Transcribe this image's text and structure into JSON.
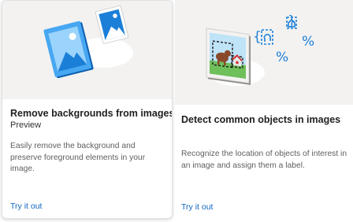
{
  "cards": [
    {
      "title": "Remove backgrounds from images",
      "subtitle": "Preview",
      "description": "Easily remove the background and preserve foreground elements in your image.",
      "link_label": "Try it out",
      "illustration": "image-background-removal-illustration"
    },
    {
      "title": "Detect common objects in images",
      "description": "Recognize the location of objects of interest in an image and assign them a label.",
      "link_label": "Try it out",
      "illustration": "object-detection-illustration",
      "illustration_glyphs": [
        "{",
        "}",
        "%",
        "%"
      ]
    }
  ],
  "colors": {
    "link": "#1266c0",
    "accent_blue": "#1b7fd8",
    "hero_background": "#f3f2f1"
  }
}
